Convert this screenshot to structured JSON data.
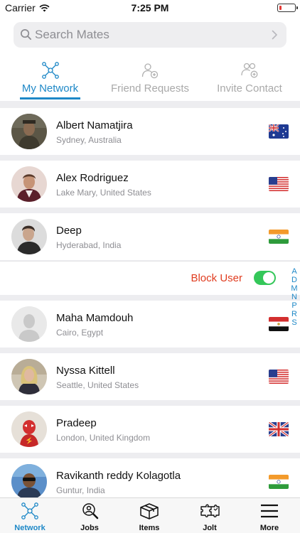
{
  "status_bar": {
    "carrier": "Carrier",
    "time": "7:25 PM"
  },
  "search": {
    "placeholder": "Search Mates",
    "value": ""
  },
  "tabs": [
    {
      "label": "My Network",
      "icon": "network-icon",
      "active": true
    },
    {
      "label": "Friend Requests",
      "icon": "friend-requests-icon",
      "active": false
    },
    {
      "label": "Invite Contact",
      "icon": "invite-contact-icon",
      "active": false
    }
  ],
  "mates": [
    {
      "name": "Albert Namatjira",
      "location": "Sydney, Australia",
      "flag": "australia-flag-icon"
    },
    {
      "name": "Alex Rodriguez",
      "location": "Lake Mary, United States",
      "flag": "usa-flag-icon"
    },
    {
      "name": "Deep",
      "location": "Hyderabad, India",
      "flag": "india-flag-icon"
    },
    {
      "name": "Maha Mamdouh",
      "location": "Cairo, Egypt",
      "flag": "egypt-flag-icon"
    },
    {
      "name": "Nyssa Kittell",
      "location": "Seattle, United States",
      "flag": "usa-flag-icon"
    },
    {
      "name": "Pradeep",
      "location": "London, United Kingdom",
      "flag": "uk-flag-icon"
    },
    {
      "name": "Ravikanth reddy Kolagotla",
      "location": "Guntur, India",
      "flag": "india-flag-icon"
    }
  ],
  "block_user": {
    "label": "Block User",
    "enabled": true
  },
  "index_letters": [
    "A",
    "D",
    "M",
    "N",
    "P",
    "R",
    "S"
  ],
  "tab_bar": [
    {
      "label": "Network",
      "icon": "network-icon",
      "active": true
    },
    {
      "label": "Jobs",
      "icon": "jobs-icon",
      "active": false
    },
    {
      "label": "Items",
      "icon": "items-box-icon",
      "active": false
    },
    {
      "label": "Jolt",
      "icon": "jolt-puzzle-icon",
      "active": false
    },
    {
      "label": "More",
      "icon": "hamburger-menu-icon",
      "active": false
    }
  ],
  "colors": {
    "accent": "#1e88c7",
    "danger": "#e03c1f",
    "toggle_on": "#34c759"
  }
}
